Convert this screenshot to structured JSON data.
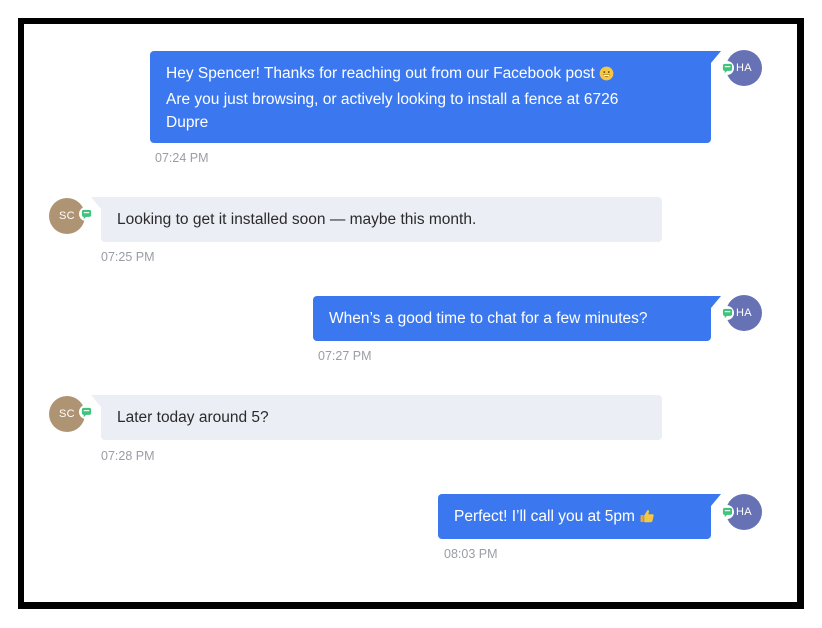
{
  "messages": [
    {
      "direction": "outgoing",
      "avatar_initials": "HA",
      "lines": [
        "Hey Spencer! Thanks for reaching out from our Facebook post",
        "Are you just browsing, or actively looking to install a fence at 6726",
        "Dupre"
      ],
      "emoji": "grinning-face",
      "time": "07:24 PM"
    },
    {
      "direction": "incoming",
      "avatar_initials": "SC",
      "text": "Looking to get it installed soon — maybe this month.",
      "time": "07:25 PM"
    },
    {
      "direction": "outgoing",
      "avatar_initials": "HA",
      "text": "When’s a good time to chat for a few minutes?",
      "time": "07:27 PM"
    },
    {
      "direction": "incoming",
      "avatar_initials": "SC",
      "text": "Later today around 5?",
      "time": "07:28 PM"
    },
    {
      "direction": "outgoing",
      "avatar_initials": "HA",
      "text": "Perfect! I’ll call you at 5pm",
      "emoji": "thumbs-up",
      "time": "08:03 PM"
    }
  ],
  "colors": {
    "outgoing_bubble": "#3b78f0",
    "incoming_bubble": "#eceef6",
    "agent_avatar": "#6772b5",
    "contact_avatar": "#ae9473",
    "channel_badge": "#3ec47c",
    "timestamp": "#9a9da5"
  },
  "icons": {
    "channel": "sms-chat-icon"
  }
}
